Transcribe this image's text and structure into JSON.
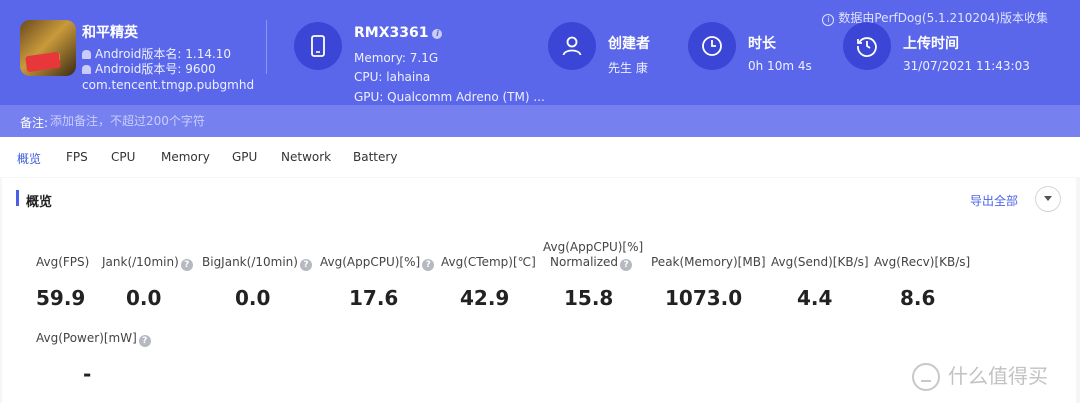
{
  "header": {
    "notice": "数据由PerfDog(5.1.210204)版本收集",
    "app": {
      "name": "和平精英",
      "version_name": "Android版本名: 1.14.10",
      "version_code": "Android版本号: 9600",
      "package": "com.tencent.tmgp.pubgmhd"
    },
    "device": {
      "model": "RMX3361",
      "memory": "Memory: 7.1G",
      "cpu": "CPU: lahaina",
      "gpu": "GPU: Qualcomm Adreno (TM) ..."
    },
    "creator": {
      "title": "创建者",
      "value": "先生 康"
    },
    "duration": {
      "title": "时长",
      "value": "0h 10m 4s"
    },
    "upload": {
      "title": "上传时间",
      "value": "31/07/2021 11:43:03"
    },
    "icons": [
      "phone-icon",
      "user-icon",
      "clock-icon",
      "history-icon",
      "android-icon",
      "info-icon"
    ]
  },
  "notes": {
    "label": "备注:",
    "placeholder": "添加备注，不超过200个字符"
  },
  "tabs": [
    "概览",
    "FPS",
    "CPU",
    "Memory",
    "GPU",
    "Network",
    "Battery"
  ],
  "active_tab": "概览",
  "overview": {
    "title": "概览",
    "export": "导出全部",
    "metrics": [
      {
        "label": "Avg(FPS)",
        "value": "59.9"
      },
      {
        "label": "Jank(/10min)",
        "value": "0.0"
      },
      {
        "label": "BigJank(/10min)",
        "value": "0.0"
      },
      {
        "label": "Avg(AppCPU)[%]",
        "value": "17.6"
      },
      {
        "label": "Avg(CTemp)[℃]",
        "value": "42.9"
      },
      {
        "label_line1": "Avg(AppCPU)[%]",
        "label_line2": "Normalized",
        "value": "15.8"
      },
      {
        "label": "Peak(Memory)[MB]",
        "value": "1073.0"
      },
      {
        "label": "Avg(Send)[KB/s]",
        "value": "4.4"
      },
      {
        "label": "Avg(Recv)[KB/s]",
        "value": "8.6"
      },
      {
        "label": "Avg(Power)[mW]",
        "value": "-"
      }
    ]
  },
  "watermark": "什么值得买",
  "colors": {
    "header": "#5a67ea",
    "accent": "#4c5ee8",
    "link": "#4c64e8"
  }
}
